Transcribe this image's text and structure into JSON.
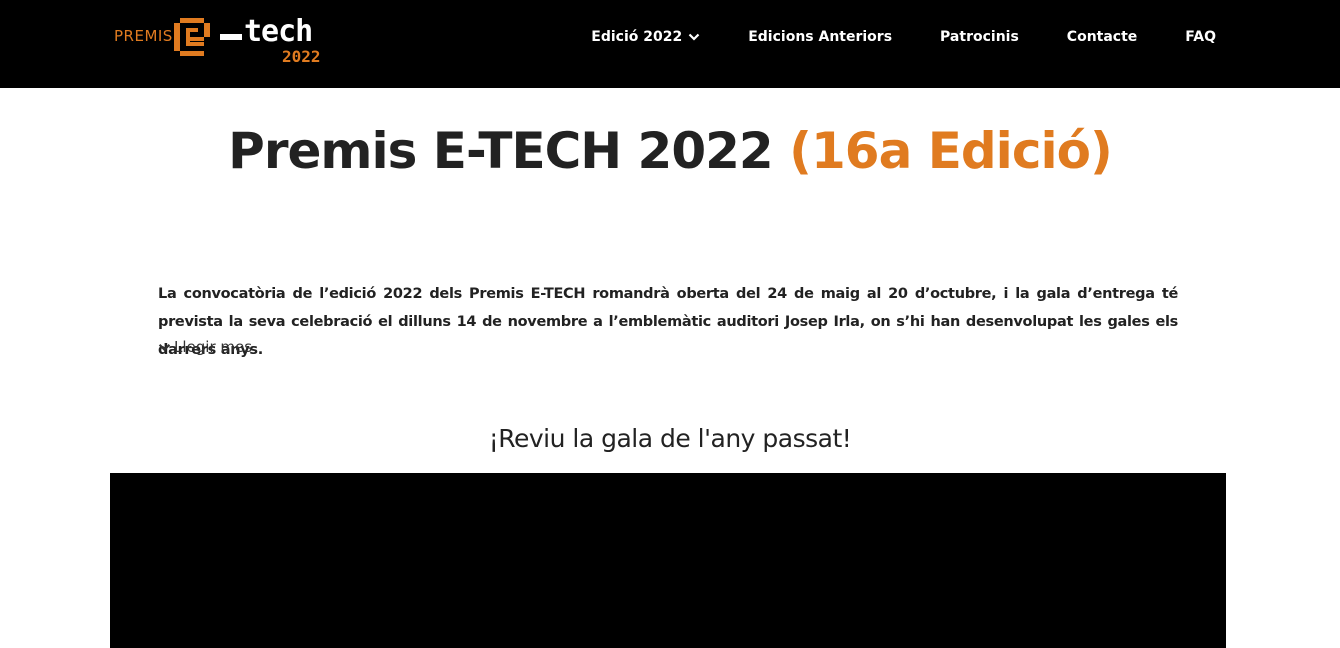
{
  "header": {
    "logo": {
      "prefix": "PREMIS",
      "e_letter": "e",
      "word": "tech",
      "year": "2022"
    },
    "nav": [
      {
        "label": "Edició 2022",
        "has_dropdown": true,
        "icon": "chevron-down-icon"
      },
      {
        "label": "Edicions Anteriors"
      },
      {
        "label": "Patrocinis"
      },
      {
        "label": "Contacte"
      },
      {
        "label": "FAQ"
      }
    ]
  },
  "main": {
    "title": "Premis E-TECH 2022",
    "title_accent": "(16a Edició)",
    "intro": "La convocatòria de l’edició 2022 dels Premis E-TECH romandrà oberta del 24 de maig al 20 d’octubre, i la gala d’entrega té prevista la seva celebració el dilluns 14 de novembre a l’emblemàtic auditori Josep Irla, on s’hi han desenvolupat les gales els darrers anys.",
    "read_more": "Llegir mes",
    "read_more_icon": "chevron-down-icon",
    "subtitle": "¡Reviu la gala de l'any passat!"
  },
  "colors": {
    "accent": "#e07b20",
    "header_bg": "#000000",
    "text": "#222222",
    "video_bg": "#000000"
  }
}
